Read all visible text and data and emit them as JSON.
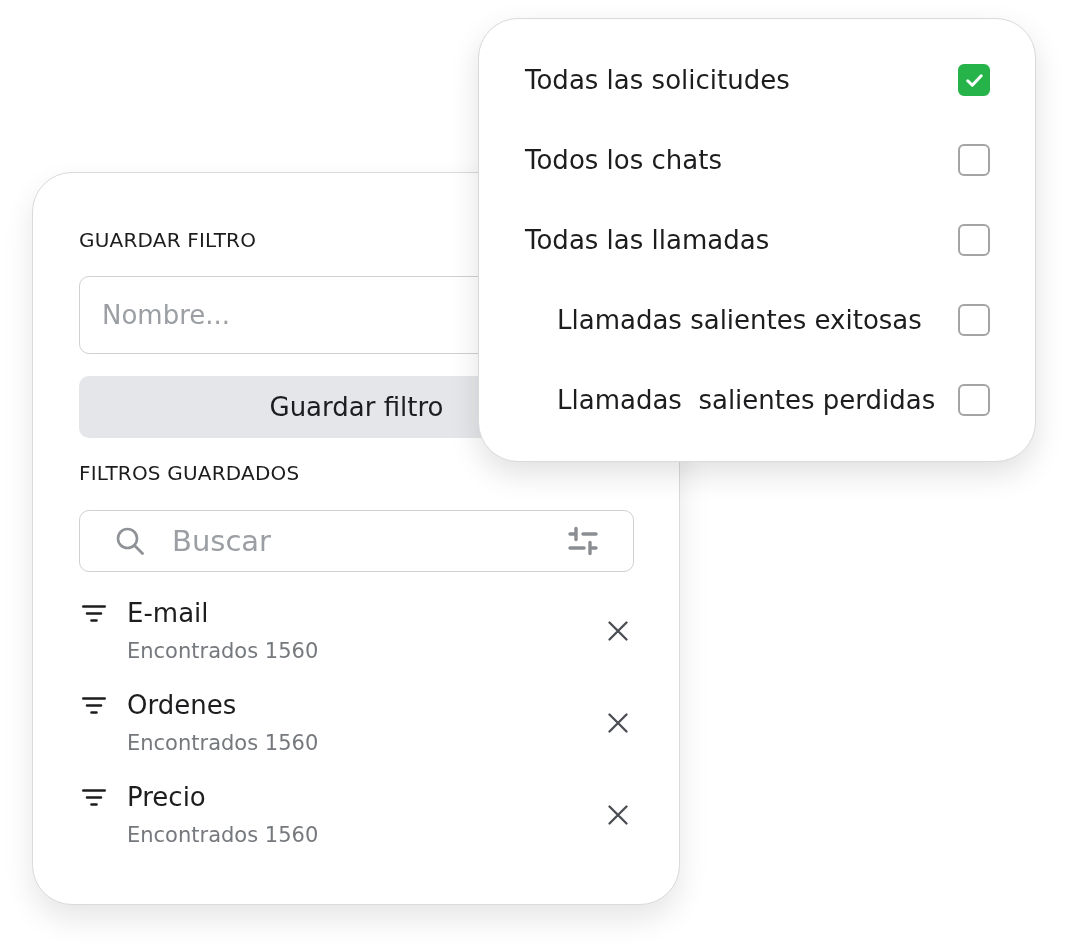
{
  "save_filter": {
    "heading": "GUARDAR FILTRO",
    "name_field": {
      "placeholder": "Nombre..."
    },
    "save_button": "Guardar filtro"
  },
  "saved_filters": {
    "heading": "FILTROS GUARDADOS",
    "search": {
      "placeholder": "Buscar"
    },
    "items": [
      {
        "name": "E-mail",
        "count": "Encontrados 1560"
      },
      {
        "name": "Ordenes",
        "count": "Encontrados 1560"
      },
      {
        "name": "Precio",
        "count": "Encontrados 1560"
      }
    ]
  },
  "filter_menu": {
    "options": [
      {
        "label": "Todas las solicitudes",
        "checked": true
      },
      {
        "label": "Todos los chats",
        "checked": false
      },
      {
        "label": "Todas las llamadas",
        "checked": false,
        "children": [
          {
            "label": "Llamadas salientes exitosas",
            "checked": false
          },
          {
            "label": "Llamadas  salientes perdidas",
            "checked": false
          }
        ]
      }
    ]
  }
}
